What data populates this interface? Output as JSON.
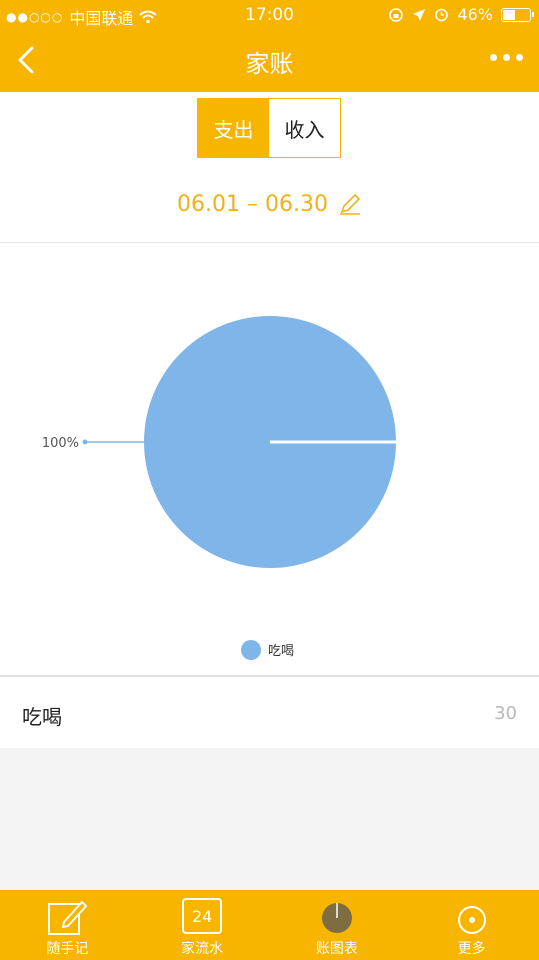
{
  "status_bar": {
    "carrier": "中国联通",
    "time": "17:00",
    "battery_percent": "46%",
    "battery_level": 0.46,
    "icons": [
      "signal-dots-icon",
      "wifi-icon",
      "rotation-lock-icon",
      "location-arrow-icon",
      "alarm-icon",
      "battery-icon"
    ]
  },
  "nav": {
    "title": "家账",
    "back_icon": "chevron-left-icon",
    "more_icon": "more-dots-icon"
  },
  "segment": {
    "expense": "支出",
    "income": "收入",
    "selected": "支出"
  },
  "date_range": {
    "text": "06.01 – 06.30",
    "edit_icon": "pencil-icon"
  },
  "chart_data": {
    "type": "pie",
    "slices": [
      {
        "name": "吃喝",
        "value": 30,
        "percent": 100,
        "label": "100%",
        "color": "#7fb5e8"
      }
    ],
    "legend": [
      "吃喝"
    ],
    "legend_position": "bottom"
  },
  "list": [
    {
      "name": "吃喝",
      "amount": "30"
    }
  ],
  "tabs": [
    {
      "label": "随手记",
      "icon": "note-edit-icon"
    },
    {
      "label": "家流水",
      "icon": "calendar-icon",
      "icon_text": "24"
    },
    {
      "label": "账图表",
      "icon": "chart-icon"
    },
    {
      "label": "更多",
      "icon": "more-icon"
    }
  ],
  "colors": {
    "primary": "#f8b500",
    "pie": "#7fb5e8"
  }
}
